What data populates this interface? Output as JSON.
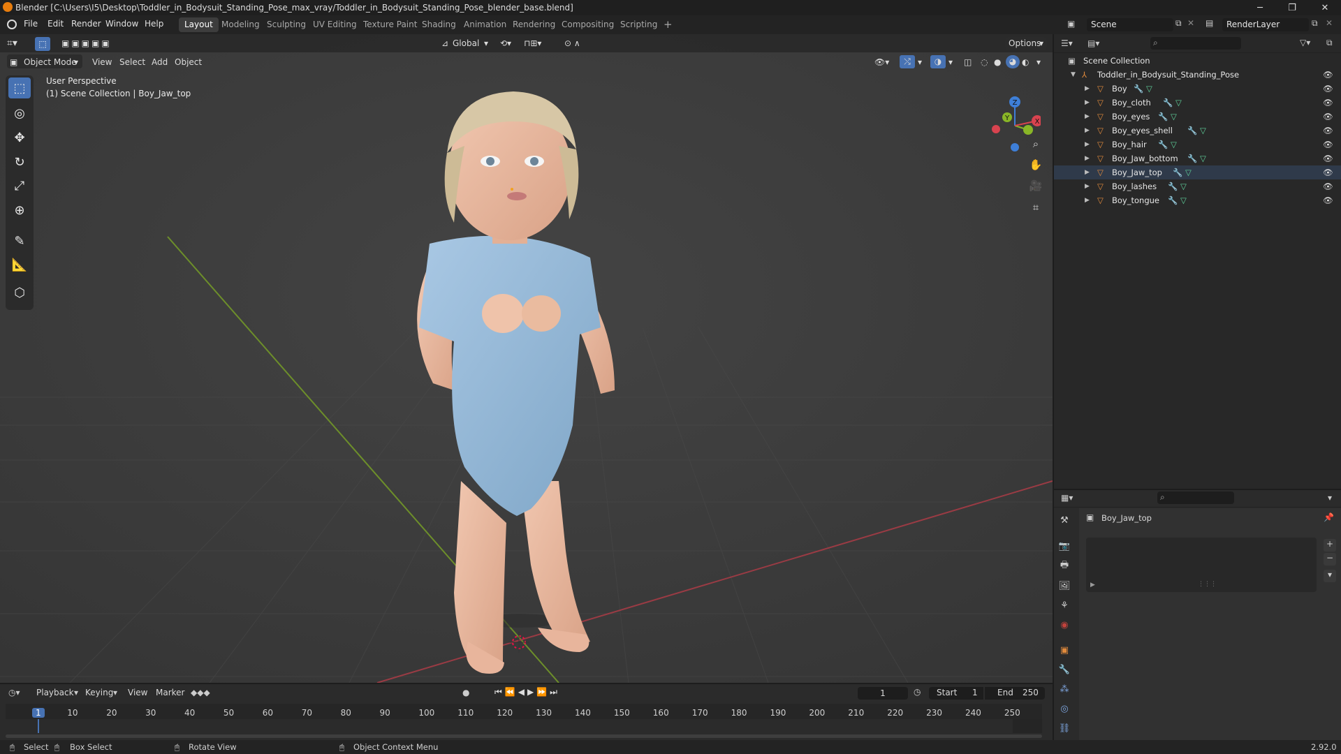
{
  "title_bar": {
    "title": "Blender [C:\\Users\\I5\\Desktop\\Toddler_in_Bodysuit_Standing_Pose_max_vray/Toddler_in_Bodysuit_Standing_Pose_blender_base.blend]",
    "minimize": "─",
    "maximize": "❐",
    "close": "✕"
  },
  "menu": [
    "File",
    "Edit",
    "Render",
    "Window",
    "Help"
  ],
  "workspaces": [
    "Layout",
    "Modeling",
    "Sculpting",
    "UV Editing",
    "Texture Paint",
    "Shading",
    "Animation",
    "Rendering",
    "Compositing",
    "Scripting"
  ],
  "add_workspace": "+",
  "scene": {
    "name": "Scene",
    "render_layer": "RenderLayer"
  },
  "viewport": {
    "transform_orientation": "Global",
    "options_label": "Options",
    "mode": "Object Mode",
    "header_menus": [
      "View",
      "Select",
      "Add",
      "Object"
    ],
    "overlay_line1": "User Perspective",
    "overlay_line2": "(1) Scene Collection | Boy_Jaw_top",
    "gizmo_axes": {
      "x": "X",
      "y": "Y",
      "z": "Z",
      "x_color": "#d8434f",
      "y_color": "#89b627",
      "z_color": "#3e7fd8"
    }
  },
  "tools": [
    {
      "name": "select-box-tool-icon",
      "glyph": "⬚",
      "active": true
    },
    {
      "name": "cursor-tool-icon",
      "glyph": "◎",
      "active": false
    },
    {
      "name": "move-tool-icon",
      "glyph": "✥",
      "active": false
    },
    {
      "name": "rotate-tool-icon",
      "glyph": "↻",
      "active": false
    },
    {
      "name": "scale-tool-icon",
      "glyph": "⤢",
      "active": false
    },
    {
      "name": "transform-tool-icon",
      "glyph": "⊕",
      "active": false
    },
    {
      "name": "annotate-tool-icon",
      "glyph": "✎",
      "active": false
    },
    {
      "name": "measure-tool-icon",
      "glyph": "📐",
      "active": false
    },
    {
      "name": "add-cube-tool-icon",
      "glyph": "⬡",
      "active": false
    }
  ],
  "outliner": {
    "root": "Scene Collection",
    "collection": "Toddler_in_Bodysuit_Standing_Pose",
    "objects": [
      "Boy",
      "Boy_cloth",
      "Boy_eyes",
      "Boy_eyes_shell",
      "Boy_hair",
      "Boy_Jaw_bottom",
      "Boy_Jaw_top",
      "Boy_lashes",
      "Boy_tongue"
    ],
    "active_object": "Boy_Jaw_top"
  },
  "properties": {
    "object_name": "Boy_Jaw_top"
  },
  "timeline": {
    "menus": [
      "Playback",
      "Keying",
      "View",
      "Marker"
    ],
    "current_frame": "1",
    "start_label": "Start",
    "start": "1",
    "end_label": "End",
    "end": "250",
    "ticks": [
      "1",
      "10",
      "20",
      "30",
      "40",
      "50",
      "60",
      "70",
      "80",
      "90",
      "100",
      "110",
      "120",
      "130",
      "140",
      "150",
      "160",
      "170",
      "180",
      "190",
      "200",
      "210",
      "220",
      "230",
      "240",
      "250"
    ]
  },
  "status_bar": {
    "select": "Select",
    "box_select": "Box Select",
    "rotate_view": "Rotate View",
    "context_menu": "Object Context Menu",
    "version": "2.92.0"
  },
  "colors": {
    "accent": "#4772b3",
    "object_orange": "#e08a3c",
    "mesh_green": "#5fcf9a",
    "modifier_blue": "#7ea6e0"
  }
}
